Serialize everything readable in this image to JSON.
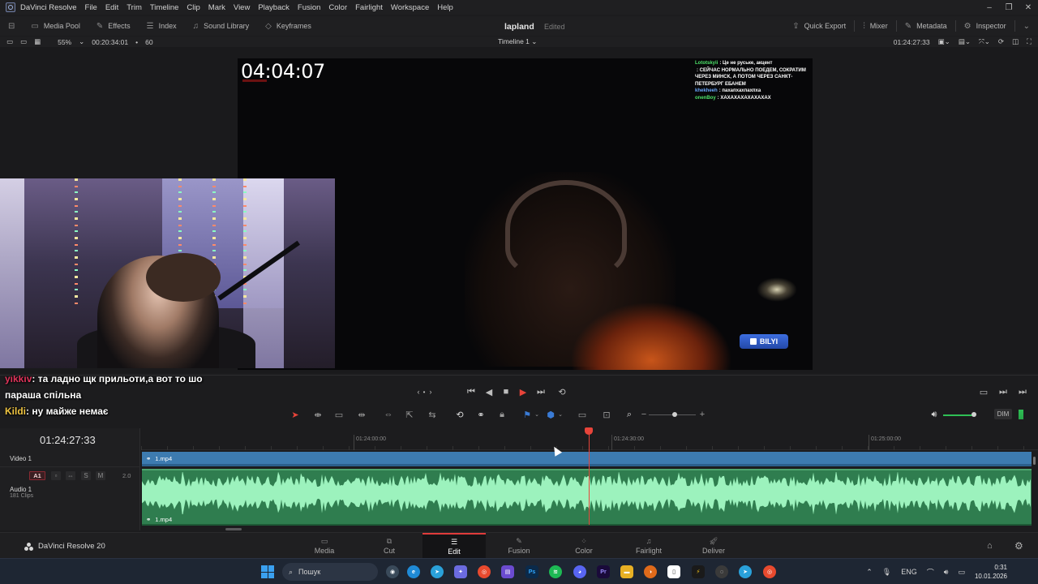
{
  "app": {
    "name": "DaVinci Resolve",
    "brand_label": "DaVinci Resolve 20"
  },
  "menu": {
    "items": [
      "File",
      "Edit",
      "Trim",
      "Timeline",
      "Clip",
      "Mark",
      "View",
      "Playback",
      "Fusion",
      "Color",
      "Fairlight",
      "Workspace",
      "Help"
    ]
  },
  "toolbar": {
    "left": [
      "Media Pool",
      "Effects",
      "Index",
      "Sound Library",
      "Keyframes"
    ],
    "project_title": "lapland",
    "project_status": "Edited",
    "right": [
      "Quick Export",
      "Mixer",
      "Metadata",
      "Inspector"
    ]
  },
  "viewer_header": {
    "zoom": "55%",
    "source_timecode": "00:20:34:01",
    "fps": "60",
    "timeline_name": "Timeline 1",
    "record_timecode": "01:24:27:33"
  },
  "viewer": {
    "stream_timer": "04:04:07",
    "chat": [
      {
        "nick": "Lototskyii",
        "nick_color": "#4ee36a",
        "text": ": Це не руське, акцент"
      },
      {
        "nick": "",
        "nick_color": "#e0345b",
        "text": ": СЕЙЧАС НОРМАЛЬНО ПОЕДЕМ, СОКРАТИМ ЧЕРЕЗ МИНСК, А ПОТОМ ЧЕРЕЗ САНКТ-ПЕТЕРБУРГ ЕБАНЕМ"
      },
      {
        "nick": "khekheeh",
        "nick_color": "#6aa8ff",
        "text": ": пахапхахпахпха"
      },
      {
        "nick": "onenBoy",
        "nick_color": "#4ee36a",
        "text": ": ХАХАХАХАХАХАХАХ"
      }
    ],
    "badge_text": "BILYI",
    "subtitles": [
      {
        "nick": "yikkiv",
        "text": ": та ладно щк прильоти,а вот то шо"
      },
      {
        "nick": "",
        "text": "параша спільна"
      },
      {
        "nick": "Kildi",
        "text": ": ну майже немає"
      }
    ]
  },
  "audio_controls": {
    "dim_label": "DIM"
  },
  "timeline": {
    "timecode": "01:24:27:33",
    "ruler_labels": [
      "01:24:00:00",
      "01:24:30:00",
      "01:25:00:00"
    ],
    "tracks": {
      "video": {
        "name": "Video 1",
        "clip_name": "1.mp4"
      },
      "audio": {
        "badge": "A1",
        "solo": "S",
        "mute": "M",
        "level": "2.0",
        "name": "Audio 1",
        "clip_count": "181 Clips",
        "clip_name": "1.mp4"
      }
    },
    "colors": {
      "video_clip": "#3d7bb0",
      "audio_clip": "#2f7d4f",
      "waveform": "#a8ffc9",
      "playhead": "#e8443a"
    }
  },
  "page_nav": {
    "tabs": [
      {
        "label": "Media",
        "icon": "media-icon",
        "active": false
      },
      {
        "label": "Cut",
        "icon": "cut-icon",
        "active": false
      },
      {
        "label": "Edit",
        "icon": "edit-icon",
        "active": true
      },
      {
        "label": "Fusion",
        "icon": "fusion-icon",
        "active": false
      },
      {
        "label": "Color",
        "icon": "color-icon",
        "active": false
      },
      {
        "label": "Fairlight",
        "icon": "fairlight-icon",
        "active": false
      },
      {
        "label": "Deliver",
        "icon": "deliver-icon",
        "active": false
      }
    ]
  },
  "taskbar": {
    "search_placeholder": "Пошук",
    "language": "ENG",
    "time": "0:31",
    "date": "10.01.2026"
  }
}
